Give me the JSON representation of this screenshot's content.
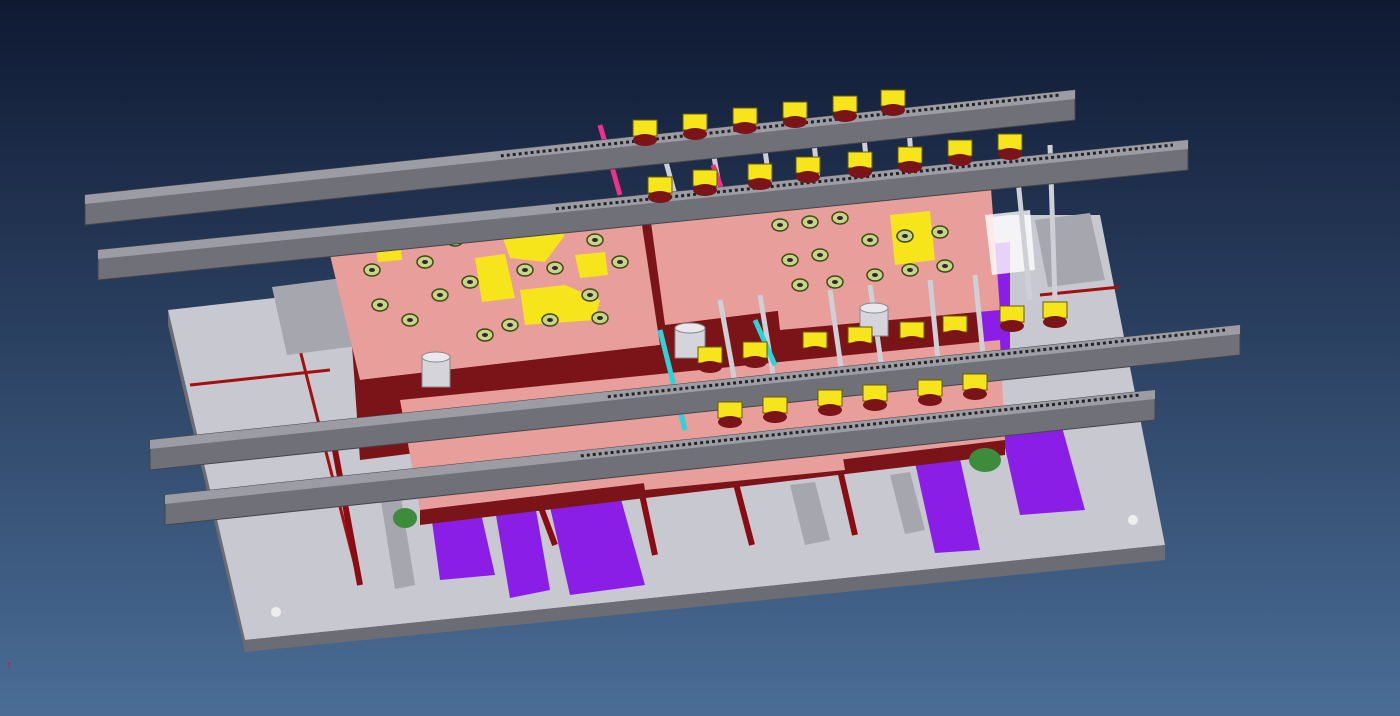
{
  "viewport": {
    "background_top": "#0f1932",
    "background_bottom": "#4a6d96",
    "compass_glyph": "↑",
    "compass_color": "#d02020"
  },
  "colors": {
    "base_plate": "#c8c8d0",
    "base_side": "#6c6c74",
    "rail": "#707078",
    "rail_light": "#9c9ca4",
    "die_pink": "#e89e9a",
    "die_dark": "#7a1418",
    "violet": "#8a1ee6",
    "yellow": "#f5e51a",
    "cyan": "#2ad4dc",
    "magenta": "#f0308a",
    "green": "#3c8c3c"
  },
  "icons": [
    "compass-icon"
  ]
}
